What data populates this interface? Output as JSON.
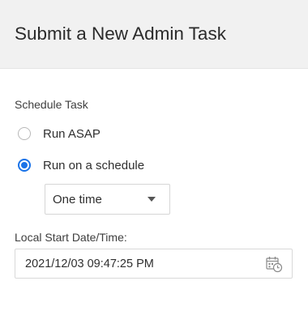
{
  "dialog": {
    "title": "Submit a New Admin Task"
  },
  "schedule": {
    "section_label": "Schedule Task",
    "options": [
      {
        "label": "Run ASAP",
        "checked": false
      },
      {
        "label": "Run on a schedule",
        "checked": true
      }
    ],
    "frequency": {
      "selected": "One time"
    }
  },
  "start": {
    "label": "Local Start Date/Time:",
    "value": "2021/12/03 09:47:25 PM"
  },
  "colors": {
    "accent": "#1a73e8",
    "header_bg": "#f1f1f1"
  },
  "icons": {
    "frequency_dropdown": "chevron-down-icon",
    "date_picker": "calendar-clock-icon"
  }
}
